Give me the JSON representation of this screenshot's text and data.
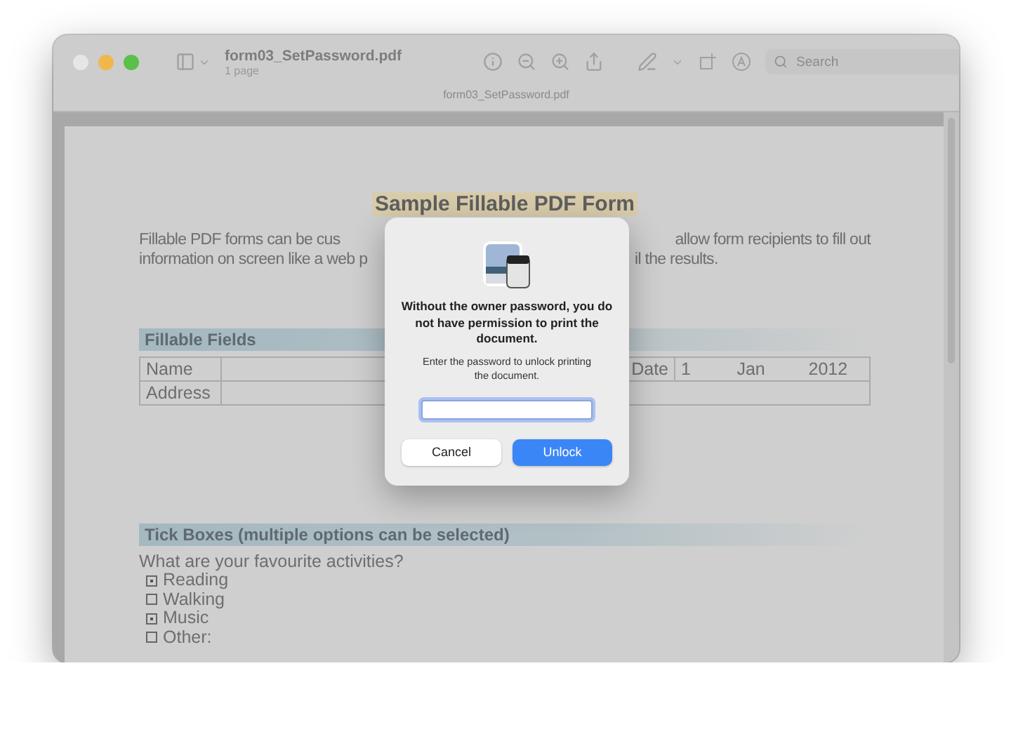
{
  "window": {
    "title": "form03_SetPassword.pdf",
    "subtitle": "1 page",
    "tab_title": "form03_SetPassword.pdf"
  },
  "toolbar": {
    "search": {
      "placeholder": "Search"
    }
  },
  "document": {
    "title": "Sample Fillable PDF Form",
    "paragraph": [
      {
        "left": "Fillable PDF forms can be cus",
        "right": "allow form recipients to fill out"
      },
      {
        "left": "information on screen like a web p",
        "right": "il the results."
      }
    ],
    "fields_section": {
      "heading": "Fillable Fields",
      "rows": [
        {
          "label": "Name",
          "date_label": "Date",
          "date": [
            "1",
            "Jan",
            "2012"
          ]
        },
        {
          "label": "Address"
        }
      ]
    },
    "ticks_section": {
      "heading": "Tick Boxes (multiple options can be selected)",
      "question": "What are your favourite activities?",
      "options": [
        {
          "label": "Reading",
          "checked": true
        },
        {
          "label": "Walking",
          "checked": false
        },
        {
          "label": "Music",
          "checked": true
        },
        {
          "label": "Other:",
          "checked": false
        }
      ]
    }
  },
  "dialog": {
    "message": "Without the owner password, you do not have permission to print the document.",
    "info": "Enter the password to unlock printing the document.",
    "password": {
      "focused": true
    },
    "buttons": [
      {
        "label": "Cancel",
        "kind": "secondary"
      },
      {
        "label": "Unlock",
        "kind": "primary"
      }
    ]
  }
}
